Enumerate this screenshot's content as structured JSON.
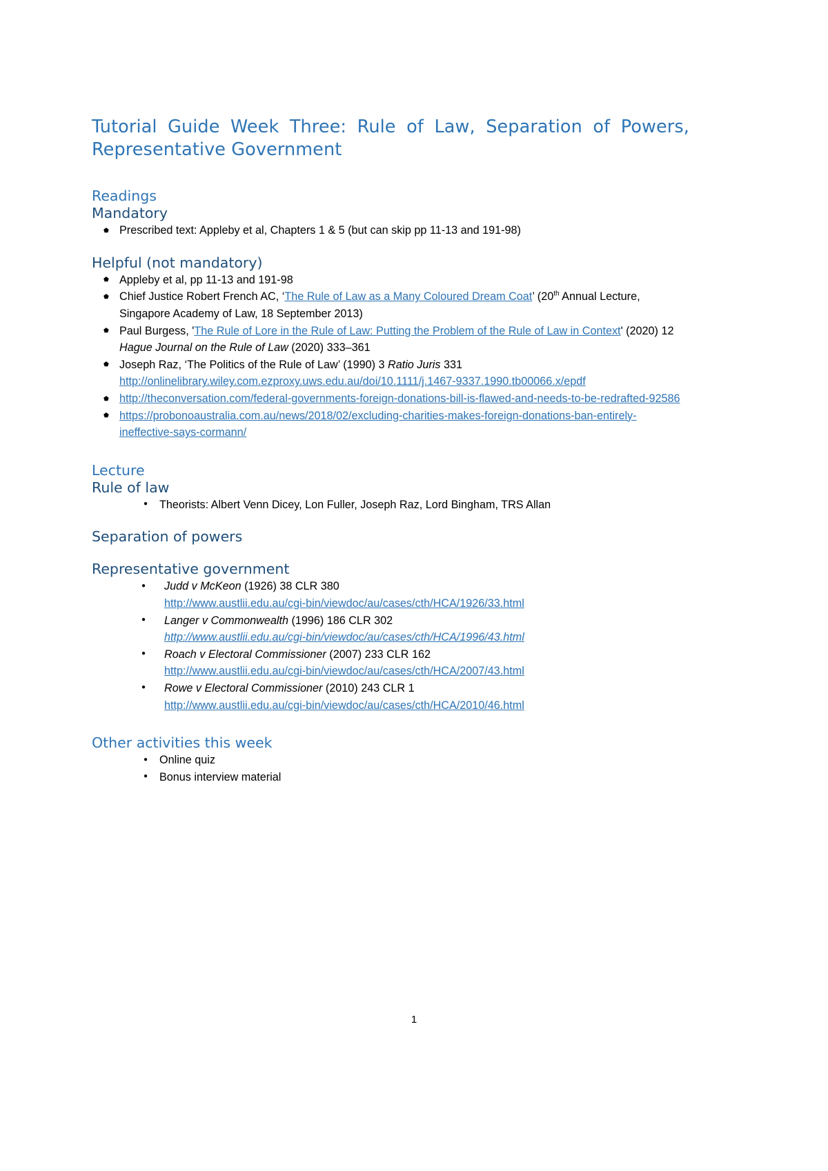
{
  "document": {
    "title_line1": "Tutorial Guide Week Three: Rule of Law, Separation of",
    "title_line2": "Powers, Representative Government",
    "page_number": "1"
  },
  "readings": {
    "heading": "Readings",
    "mandatory_heading": "Mandatory",
    "mandatory_items": [
      "Prescribed text: Appleby et al, Chapters 1 & 5 (but can skip pp 11-13 and 191-98)"
    ],
    "helpful_heading": "Helpful (not mandatory)",
    "helpful_items": [
      {
        "pre": "Appleby et al, pp 11-13 and 191-98",
        "link": "",
        "post": ""
      },
      {
        "pre": "Chief Justice Robert French AC, ‘",
        "link": "The Rule of Law as a Many Coloured Dream Coat",
        "post_a": "’ (20",
        "sup": "th",
        "post_b": " Annual Lecture, Singapore Academy of Law, 18 September 2013)"
      },
      {
        "pre": "Paul Burgess, '",
        "link": "The Rule of Lore in the Rule of Law: Putting the Problem of the Rule of Law in Context",
        "post_a": "' (2020) 12 ",
        "italic": "Hague Journal on the Rule of Law",
        "post_b": " (2020) 333–361"
      },
      {
        "pre": "Joseph Raz, ‘The Politics of the Rule of Law’ (1990) 3 ",
        "italic": "Ratio Juris",
        "post_a": " 331",
        "url": "http://onlinelibrary.wiley.com.ezproxy.uws.edu.au/doi/10.1111/j.1467-9337.1990.tb00066.x/epdf"
      },
      {
        "url": "http://theconversation.com/federal-governments-foreign-donations-bill-is-flawed-and-needs-to-be-redrafted-92586"
      },
      {
        "url": "https://probonoaustralia.com.au/news/2018/02/excluding-charities-makes-foreign-donations-ban-entirely-ineffective-says-cormann/"
      }
    ]
  },
  "lecture": {
    "heading": "Lecture",
    "rule_of_law": {
      "heading": "Rule of law",
      "items": [
        "Theorists: Albert Venn Dicey, Lon Fuller, Joseph Raz, Lord Bingham, TRS Allan"
      ]
    },
    "separation_of_powers": {
      "heading": "Separation of powers"
    },
    "representative_government": {
      "heading": "Representative government",
      "cases": [
        {
          "name": "Judd v McKeon",
          "citation": " (1926) 38 CLR 380",
          "url": "http://www.austlii.edu.au/cgi-bin/viewdoc/au/cases/cth/HCA/1926/33.html",
          "url_italic": false
        },
        {
          "name": "Langer v Commonwealth",
          "citation": " (1996) 186 CLR 302",
          "url": "http://www.austlii.edu.au/cgi-bin/viewdoc/au/cases/cth/HCA/1996/43.html",
          "url_italic": true
        },
        {
          "name": "Roach v Electoral Commissioner",
          "citation": " (2007) 233 CLR 162",
          "url": "http://www.austlii.edu.au/cgi-bin/viewdoc/au/cases/cth/HCA/2007/43.html",
          "url_italic": false
        },
        {
          "name": "Rowe v Electoral Commissioner",
          "citation": " (2010) 243 CLR 1",
          "url": "http://www.austlii.edu.au/cgi-bin/viewdoc/au/cases/cth/HCA/2010/46.html",
          "url_italic": false
        }
      ]
    }
  },
  "other_activities": {
    "heading": "Other activities this week",
    "items": [
      "Online quiz",
      "Bonus interview material"
    ]
  },
  "colors": {
    "heading_blue": "#2E74B5",
    "subheading_blue": "#1F4E79",
    "link_blue": "#2E74B5",
    "body_black": "#000000"
  }
}
